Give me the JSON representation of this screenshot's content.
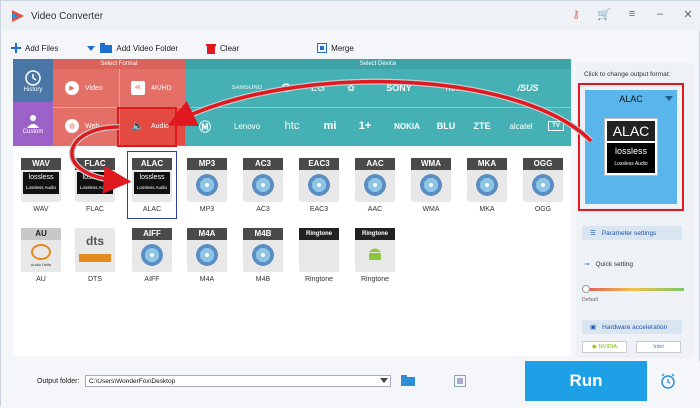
{
  "app": {
    "title": "Video Converter"
  },
  "toolbar": {
    "add_files": "Add Files",
    "add_video_folder": "Add Video Folder",
    "clear": "Clear",
    "merge": "Merge"
  },
  "categories": {
    "select_format": "Select Format",
    "select_device": "Select Device",
    "history": "History",
    "custom": "Custom",
    "video": "Video",
    "hd": "4K/HD",
    "web": "Web",
    "audio": "Audio",
    "brands_row1": [
      "",
      "SAMSUNG",
      "",
      "",
      "",
      "SONY",
      "honor",
      "/SUS"
    ],
    "brands_row2": [
      "",
      "Lenovo",
      "htc",
      "mi",
      "1+",
      "NOKIA",
      "BLU",
      "ZTE",
      "alcatel",
      "TV"
    ]
  },
  "formats": {
    "row1": [
      "WAV",
      "FLAC",
      "ALAC",
      "MP3",
      "AC3",
      "EAC3",
      "AAC",
      "WMA",
      "MKA",
      "OGG"
    ],
    "row2": [
      "AU",
      "DTS",
      "AIFF",
      "M4A",
      "M4B",
      "Ringtone",
      "Ringtone"
    ],
    "lossless": "lossless",
    "lossless_audio": "Lossless Audio",
    "au_sub": "Audio Units",
    "dts_label": "dts"
  },
  "output": {
    "caption": "Click to change output format:",
    "selected": "ALAC",
    "big_tag": "ALAC",
    "lossless": "lossless",
    "lossless_audio": "Lossless Audio"
  },
  "settings": {
    "parameter": "Parameter settings",
    "quick": "Quick setting",
    "default": "Default",
    "quality_level": 0,
    "hardware": "Hardware acceleration",
    "nvidia": "NVIDIA",
    "intel": "Intel"
  },
  "bottom": {
    "folder_label": "Output folder:",
    "folder_path": "C:\\Users\\WonderFox\\Desktop",
    "run": "Run"
  },
  "colors": {
    "accent_red": "#e0181f",
    "run_blue": "#1ea0e6",
    "audio_red": "#e46f66",
    "device_teal": "#46b1b4"
  }
}
